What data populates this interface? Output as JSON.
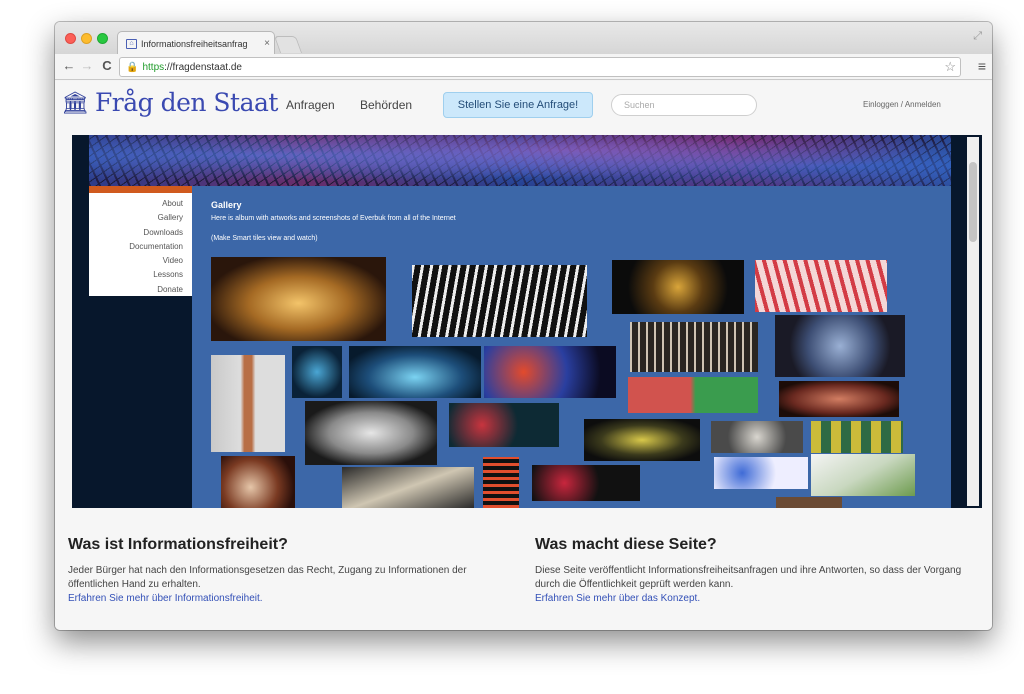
{
  "browser": {
    "tab_title": "Informationsfreiheitsanfrag",
    "tab_close": "×",
    "resize_icon": "⤢",
    "url_scheme": "https",
    "url_rest": "://fragdenstaat.de",
    "back_icon": "←",
    "forward_icon": "→",
    "reload_icon": "C",
    "star_icon": "☆",
    "menu_icon": "≡"
  },
  "site": {
    "logo_text": "Fråg den Staat",
    "logo_icon": "🏛",
    "nav": {
      "anfragen": "Anfragen",
      "behoerden": "Behörden"
    },
    "cta": "Stellen Sie eine Anfrage!",
    "search_placeholder": "Suchen",
    "login": "Einloggen / Anmelden"
  },
  "embed": {
    "menu_items": [
      "About",
      "Gallery",
      "Downloads",
      "Documentation",
      "Video",
      "Lessons",
      "Donate"
    ],
    "gallery_title": "Gallery",
    "gallery_desc": "Here is album with artworks and screenshots of Everbuk from all of the Internet",
    "gallery_note": "(Make Smart tiles view and watch)"
  },
  "info": {
    "left": {
      "title": "Was ist Informationsfreiheit?",
      "text": "Jeder Bürger hat nach den Informationsgesetzen das Recht, Zugang zu Informationen der öffentlichen Hand zu erhalten.",
      "link": "Erfahren Sie mehr über Informationsfreiheit."
    },
    "right": {
      "title": "Was macht diese Seite?",
      "text": "Diese Seite veröffentlicht Informationsfreiheitsanfragen und ihre Antworten, so dass der Vorgang durch die Öffentlichkeit geprüft werden kann.",
      "link": "Erfahren Sie mehr über das Konzept."
    }
  }
}
